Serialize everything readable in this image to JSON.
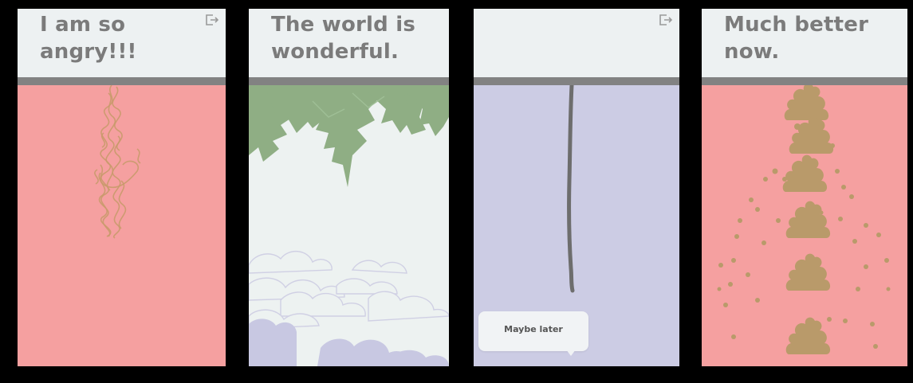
{
  "colors": {
    "background": "#000000",
    "header": "#edf1f2",
    "title_text": "#7b7b7b",
    "divider": "#828282",
    "angry_bg": "#f5a0a0",
    "happy_bg": "#edf2f1",
    "tree": "#8fae84",
    "cloud": "#c8c8e2",
    "purple_bg": "#cccce4",
    "rope": "#6d6d6d",
    "poop": "#b99a6a"
  },
  "screens": [
    {
      "title": "I am so\nangry!!!",
      "exit_icon": "exit-icon"
    },
    {
      "title": "The world is\nwonderful."
    },
    {
      "title": "",
      "exit_icon": "exit-icon",
      "popup": {
        "label": "Maybe later"
      }
    },
    {
      "title": "Much better\nnow."
    }
  ]
}
